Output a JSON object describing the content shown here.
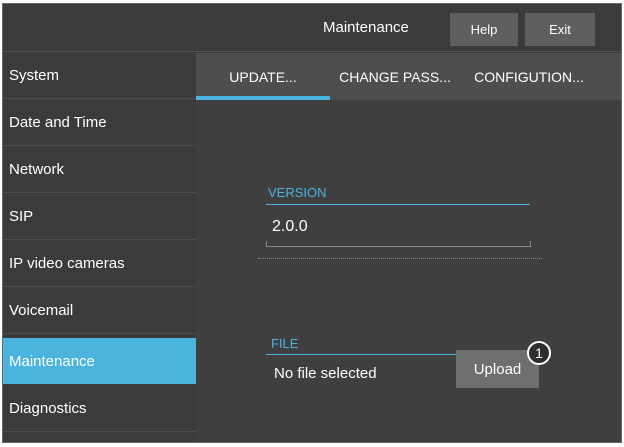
{
  "header": {
    "title": "Maintenance",
    "help_label": "Help",
    "exit_label": "Exit"
  },
  "sidebar": {
    "items": [
      {
        "label": "System",
        "active": false
      },
      {
        "label": "Date and Time",
        "active": false
      },
      {
        "label": "Network",
        "active": false
      },
      {
        "label": "SIP",
        "active": false
      },
      {
        "label": "IP video cameras",
        "active": false
      },
      {
        "label": "Voicemail",
        "active": false
      },
      {
        "label": "Maintenance",
        "active": true
      },
      {
        "label": "Diagnostics",
        "active": false
      }
    ]
  },
  "tabs": [
    {
      "label": "UPDATE...",
      "active": true
    },
    {
      "label": "CHANGE PASS...",
      "active": false
    },
    {
      "label": "CONFIGUTION...",
      "active": false
    }
  ],
  "version": {
    "label": "VERSION",
    "value": "2.0.0"
  },
  "file": {
    "label": "FILE",
    "value": "No file selected",
    "upload_label": "Upload",
    "callout": "1"
  },
  "colors": {
    "accent": "#4ab4df",
    "background": "#3b3b3b",
    "button": "#5f5f5f"
  }
}
